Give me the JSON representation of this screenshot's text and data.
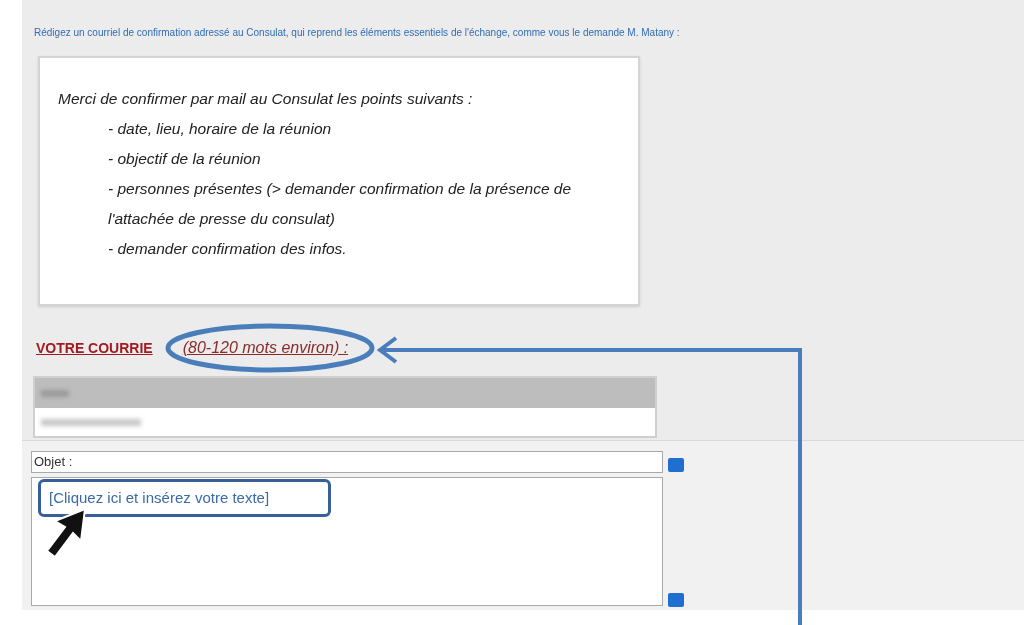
{
  "instruction": "Rédigez un courriel de confirmation adressé au Consulat, qui reprend les éléments essentiels de l'échange, comme vous le demande M. Matany :",
  "quote": {
    "intro": "Merci de confirmer par mail au Consulat les points suivants :",
    "items": [
      "- date, lieu, horaire de la réunion",
      "- objectif de la réunion",
      "- personnes présentes (> demander confirmation de la présence de l'attachée de presse du consulat)",
      "- demander confirmation des infos."
    ]
  },
  "heading": {
    "label": "VOTRE COURRIE",
    "note": "(80-120 mots environ) :"
  },
  "subject_field": {
    "label": "Objet :"
  },
  "body_field": {
    "placeholder": "[Cliquez ici et insérez votre texte]"
  }
}
